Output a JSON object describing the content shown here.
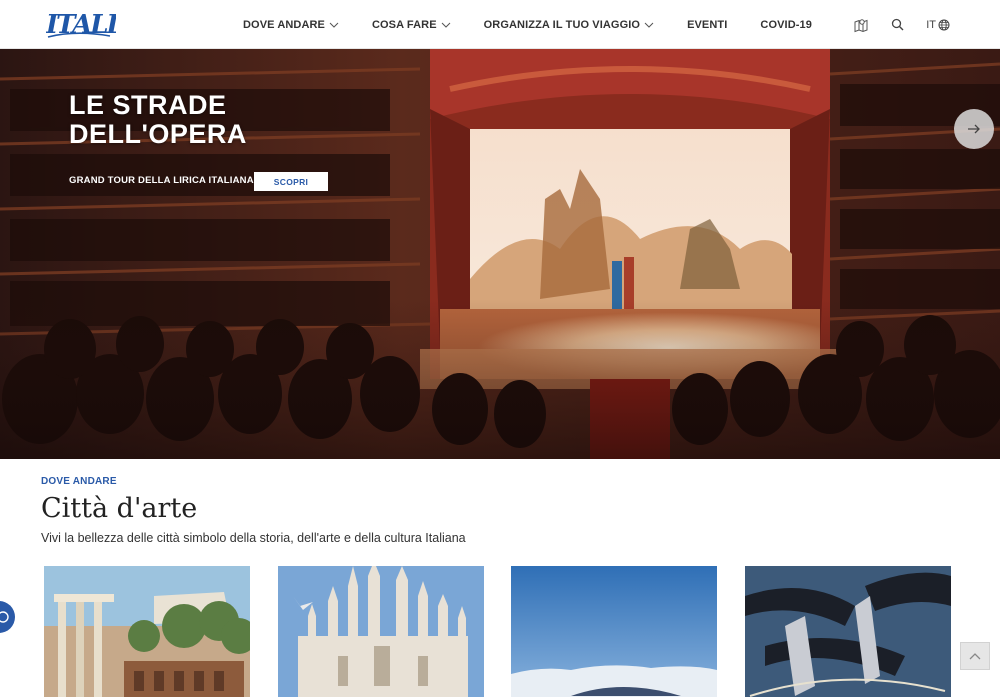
{
  "header": {
    "logo_text": "ITALIA",
    "nav": [
      {
        "label": "DOVE ANDARE",
        "has_dropdown": true
      },
      {
        "label": "COSA FARE",
        "has_dropdown": true
      },
      {
        "label": "ORGANIZZA IL TUO VIAGGIO",
        "has_dropdown": true
      },
      {
        "label": "EVENTI",
        "has_dropdown": false
      },
      {
        "label": "COVID-19",
        "has_dropdown": false
      }
    ],
    "language": "IT",
    "icons": [
      "map-icon",
      "search-icon",
      "globe-icon"
    ]
  },
  "hero": {
    "title": "LE STRADE DELL'OPERA",
    "subtitle": "GRAND TOUR DELLA LIRICA ITALIANA",
    "cta_label": "SCOPRI",
    "next_icon": "arrow-right-icon"
  },
  "section": {
    "kicker": "DOVE ANDARE",
    "title": "Città d'arte",
    "description": "Vivi la bellezza delle città simbolo della storia, dell'arte e della cultura Italiana"
  },
  "colors": {
    "brand_blue": "#2a5aa8",
    "nav_text": "#333333"
  }
}
